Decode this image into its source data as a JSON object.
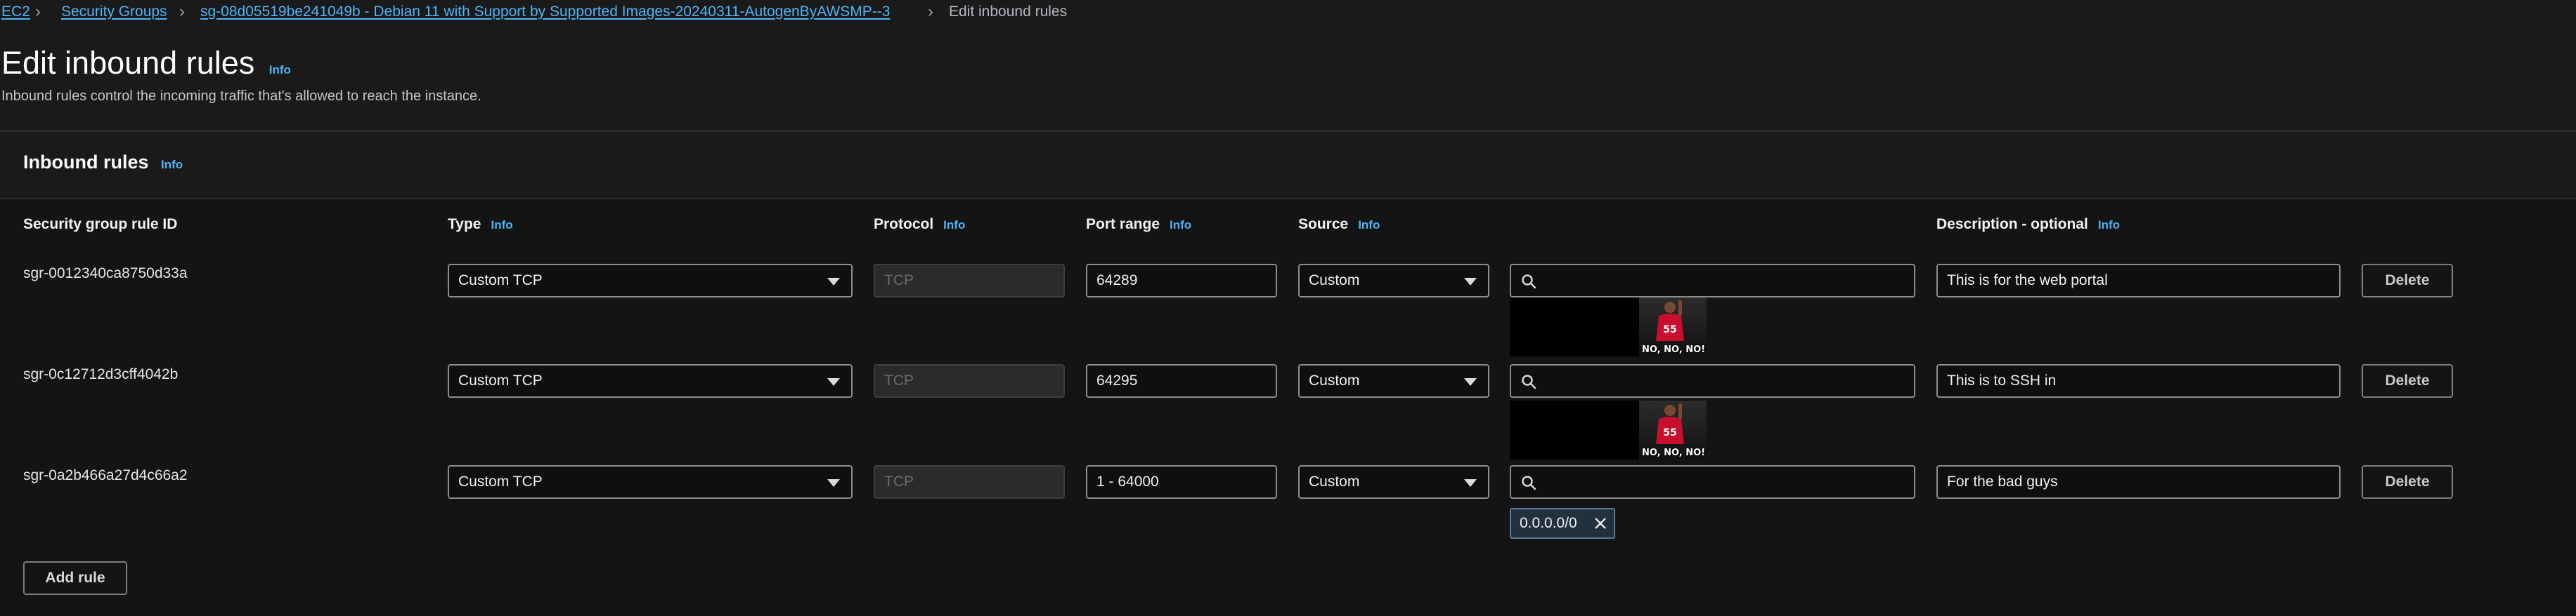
{
  "breadcrumb": {
    "items": [
      "EC2",
      "Security Groups",
      "sg-08d05519be241049b - Debian 11 with Support by Supported Images-20240311-AutogenByAWSMP--3"
    ],
    "current": "Edit inbound rules"
  },
  "page": {
    "title": "Edit inbound rules",
    "info": "Info",
    "description": "Inbound rules control the incoming traffic that's allowed to reach the instance."
  },
  "panel": {
    "title": "Inbound rules",
    "info": "Info",
    "columns": {
      "rule_id": "Security group rule ID",
      "type": "Type",
      "protocol": "Protocol",
      "port_range": "Port range",
      "source": "Source",
      "description": "Description - optional",
      "info": "Info"
    },
    "rows": [
      {
        "rule_id": "sgr-0012340ca8750d33a",
        "type": "Custom TCP",
        "protocol": "TCP",
        "port_range": "64289",
        "source": "Custom",
        "search_value": "",
        "description": "This is for the web portal",
        "delete": "Delete",
        "meme_caption": "NO, NO, NO!!!"
      },
      {
        "rule_id": "sgr-0c12712d3cff4042b",
        "type": "Custom TCP",
        "protocol": "TCP",
        "port_range": "64295",
        "source": "Custom",
        "search_value": "",
        "description": "This is to SSH in",
        "delete": "Delete",
        "meme_caption": "NO, NO, NO!!!"
      },
      {
        "rule_id": "sgr-0a2b466a27d4c66a2",
        "type": "Custom TCP",
        "protocol": "TCP",
        "port_range": "1 - 64000",
        "source": "Custom",
        "search_value": "",
        "description": "For the bad guys",
        "delete": "Delete",
        "cidr_token": "0.0.0.0/0"
      }
    ],
    "add_rule": "Add rule"
  },
  "icons": {
    "search": "search-icon",
    "dropdown": "caret-down-icon",
    "breadcrumb_separator": "chevron-right-icon",
    "remove": "close-icon"
  },
  "colors": {
    "background": "#1a1a1a",
    "panel": "#141414",
    "link": "#4fb3f6",
    "token_bg": "#23303e"
  }
}
